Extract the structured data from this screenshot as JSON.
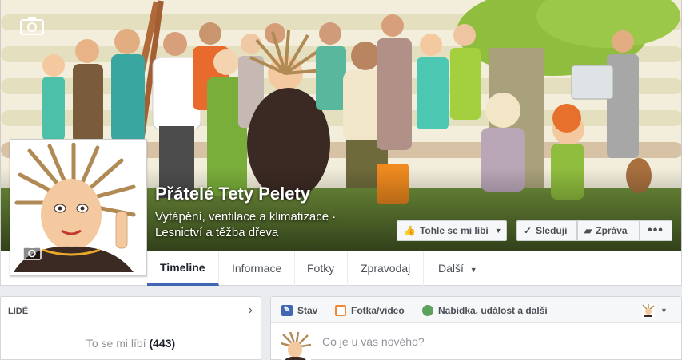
{
  "page": {
    "name": "Přátelé Tety Pelety",
    "category_line1": "Vytápění, ventilace a klimatizace ·",
    "category_line2": "Lesnictví a těžba dřeva"
  },
  "actions": {
    "like_label": "Tohle se mi líbí",
    "follow_label": "Sleduji",
    "message_label": "Zpráva",
    "more_label": "•••"
  },
  "nav": {
    "tabs": [
      {
        "label": "Timeline"
      },
      {
        "label": "Informace"
      },
      {
        "label": "Fotky"
      },
      {
        "label": "Zpravodaj"
      },
      {
        "label": "Další"
      }
    ]
  },
  "people": {
    "title": "LIDÉ",
    "likes_label": "To se mi líbí",
    "likes_count": "(443)"
  },
  "composer": {
    "tabs": [
      {
        "label": "Stav",
        "icon": "pencil-icon"
      },
      {
        "label": "Fotka/video",
        "icon": "photo-icon"
      },
      {
        "label": "Nabídka, událost a další",
        "icon": "offer-icon"
      }
    ],
    "placeholder": "Co je u vás nového?"
  },
  "colors": {
    "accent": "#4267b2",
    "cover_background": "#f3eedb",
    "stripe": "#dcd9b4"
  }
}
